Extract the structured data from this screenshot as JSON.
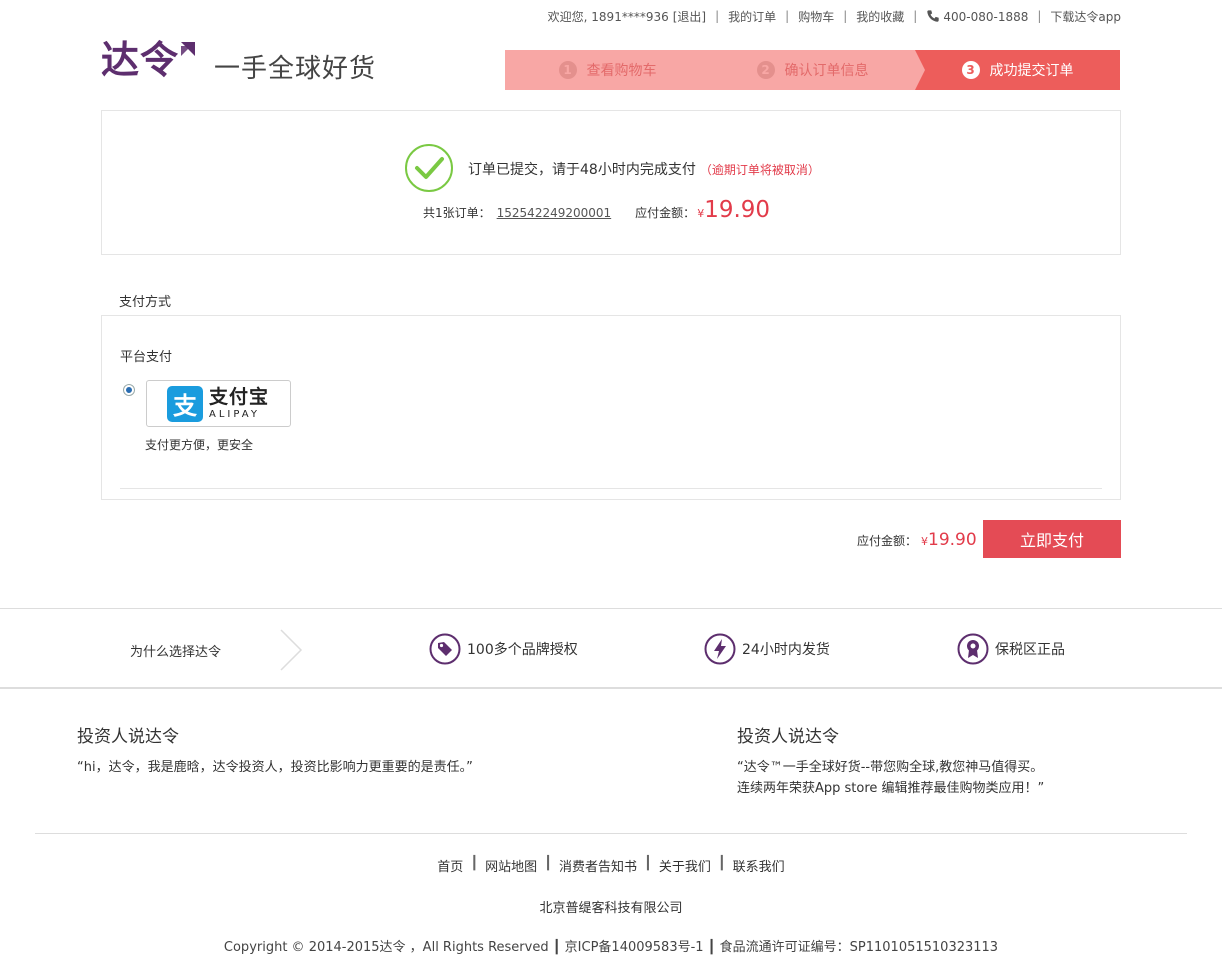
{
  "topbar": {
    "welcome": "欢迎您, 1891****936",
    "logout": "[退出]",
    "my_orders": "我的订单",
    "cart": "购物车",
    "favorites": "我的收藏",
    "phone": "400-080-1888",
    "download_app": "下载达令app"
  },
  "header": {
    "logo": "达令",
    "slogan": "一手全球好货"
  },
  "steps": [
    {
      "num": "1",
      "label": "查看购物车"
    },
    {
      "num": "2",
      "label": "确认订单信息"
    },
    {
      "num": "3",
      "label": "成功提交订单"
    }
  ],
  "order": {
    "message": "订单已提交，请于48小时内完成支付",
    "warning": "（逾期订单将被取消）",
    "count_label": "共1张订单：",
    "order_number": "152542249200001",
    "amount_label": "应付金额：",
    "currency": "¥",
    "amount": "19.90"
  },
  "payment": {
    "title": "支付方式",
    "platform_label": "平台支付",
    "alipay_icon": "支",
    "alipay_cn": "支付宝",
    "alipay_en": "ALIPAY",
    "alipay_desc": "支付更方便，更安全",
    "total_label": "应付金额：",
    "currency": "¥",
    "total_amount": "19.90",
    "pay_button": "立即支付"
  },
  "why": {
    "title": "为什么选择达令",
    "features": [
      {
        "icon": "tag-icon",
        "label": "100多个品牌授权"
      },
      {
        "icon": "lightning-icon",
        "label": "24小时内发货"
      },
      {
        "icon": "badge-icon",
        "label": "保税区正品"
      }
    ]
  },
  "investors": [
    {
      "title": "投资人说达令",
      "quote": "“hi，达令，我是鹿晗，达令投资人，投资比影响力更重要的是责任。”"
    },
    {
      "title": "投资人说达令",
      "quote_line1": "“达令™一手全球好货--带您购全球,教您神马值得买。",
      "quote_line2": "连续两年荣获App store 编辑推荐最佳购物类应用！”"
    }
  ],
  "footer": {
    "links": [
      "首页",
      "网站地图",
      "消费者告知书",
      "关于我们",
      "联系我们"
    ],
    "company": "北京普缇客科技有限公司",
    "copyright": "Copyright © 2014-2015达令 ，All Rights Reserved ┃ 京ICP备14009583号-1 ┃ 食品流通许可证编号：SP1101051510323113"
  },
  "colors": {
    "brand_purple": "#5d2e6e",
    "step_light": "#f8a7a5",
    "step_active": "#ed5d5b",
    "price_red": "#e23b4a",
    "pay_button": "#e44b55",
    "alipay_blue": "#1a9cde",
    "success_green": "#7ac943"
  }
}
